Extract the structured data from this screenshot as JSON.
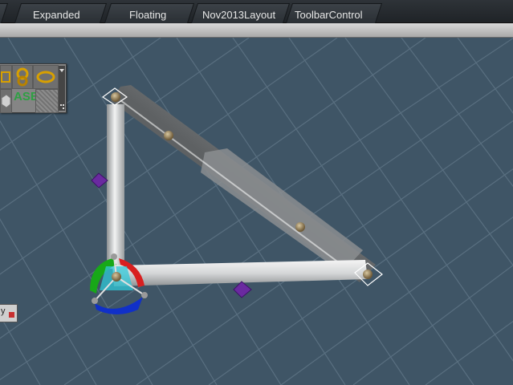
{
  "tabs": [
    {
      "label": "Expanded"
    },
    {
      "label": "Floating"
    },
    {
      "label": "Nov2013Layout"
    },
    {
      "label": "ToolbarControl"
    }
  ],
  "palette": {
    "ase_label": "ASE"
  },
  "side_widget": {
    "label": "y"
  },
  "colors": {
    "viewport_bg": "#3f5566",
    "grid": "#5d7384",
    "beam": "#cfd2d3",
    "handle_purple": "#6a2aa0",
    "gizmo_green": "#18a818",
    "gizmo_red": "#d82020",
    "gizmo_blue": "#1030c8",
    "gizmo_cyan": "#30c8d8"
  },
  "icons": [
    "frame-icon",
    "chain-icon",
    "ring-icon",
    "cube-icon",
    "texture-icon",
    "palette-menu-icon",
    "resize-grip-icon",
    "close-icon"
  ]
}
